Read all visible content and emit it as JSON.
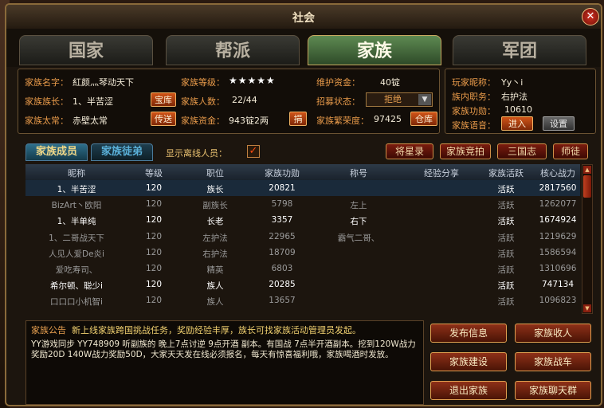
{
  "window": {
    "title": "社会",
    "close_glyph": "✕"
  },
  "tabs": [
    {
      "label": "国家",
      "active": false
    },
    {
      "label": "帮派",
      "active": false
    },
    {
      "label": "家族",
      "active": true
    },
    {
      "label": "军团",
      "active": false
    }
  ],
  "family": {
    "name_label": "家族名字：",
    "name": "紅颜灬琴动天下",
    "leader_label": "家族族长：",
    "leader": "1、半苦涩",
    "vice_label": "家族太常：",
    "vice": "赤壁太常",
    "level_label": "家族等级：",
    "level_stars": "★★★★★",
    "members_label": "家族人数：",
    "members": "22/44",
    "funds_label": "家族资金：",
    "funds": "943锭2两",
    "upkeep_label": "维护资金：",
    "upkeep": "40锭",
    "recruit_label": "招募状态：",
    "recruit_value": "拒绝",
    "prosperity_label": "家族繁荣度：",
    "prosperity": "97425",
    "btn_treasury": "宝库",
    "btn_transfer": "传送",
    "btn_donate": "捐",
    "btn_warehouse": "仓库"
  },
  "player": {
    "nick_label": "玩家昵称：",
    "nick": "Yy丶i",
    "role_label": "族内职务：",
    "role": "右护法",
    "merit_label": "家族功勋：",
    "merit": "10610",
    "voice_label": "家族语音：",
    "btn_enter": "进入",
    "btn_settings": "设置"
  },
  "subtabs": {
    "members": "家族成员",
    "apprentices": "家族徒弟"
  },
  "show_offline_label": "显示离线人员：",
  "show_offline_checked": "✓",
  "action_buttons": [
    "将星录",
    "家族竞拍",
    "三国志",
    "师徒"
  ],
  "table": {
    "headers": [
      "昵称",
      "等级",
      "职位",
      "家族功勋",
      "称号",
      "经验分享",
      "家族活跃",
      "核心战力"
    ],
    "rows": [
      {
        "name": "1、半苦涩",
        "level": "120",
        "position": "族长",
        "merit": "20821",
        "title": "",
        "exp": "",
        "active": "活跃",
        "power": "2817560",
        "online": true
      },
      {
        "name": "BizArt丶欧阳",
        "level": "120",
        "position": "副族长",
        "merit": "5798",
        "title": "左上",
        "exp": "",
        "active": "活跃",
        "power": "1262077",
        "online": false
      },
      {
        "name": "1、半单纯",
        "level": "120",
        "position": "长老",
        "merit": "3357",
        "title": "右下",
        "exp": "",
        "active": "活跃",
        "power": "1674924",
        "online": true
      },
      {
        "name": "1、二哥战天下",
        "level": "120",
        "position": "左护法",
        "merit": "22965",
        "title": "霸气二哥、",
        "exp": "",
        "active": "活跃",
        "power": "1219629",
        "online": false
      },
      {
        "name": "人见人爱De炎i",
        "level": "120",
        "position": "右护法",
        "merit": "18709",
        "title": "",
        "exp": "",
        "active": "活跃",
        "power": "1586594",
        "online": false
      },
      {
        "name": "爱吃寿司、",
        "level": "120",
        "position": "精英",
        "merit": "6803",
        "title": "",
        "exp": "",
        "active": "活跃",
        "power": "1310696",
        "online": false
      },
      {
        "name": "希尔顿、聪少i",
        "level": "120",
        "position": "族人",
        "merit": "20285",
        "title": "",
        "exp": "",
        "active": "活跃",
        "power": "747134",
        "online": true
      },
      {
        "name": "口口口小机智i",
        "level": "120",
        "position": "族人",
        "merit": "13657",
        "title": "",
        "exp": "",
        "active": "活跃",
        "power": "1096823",
        "online": false
      }
    ]
  },
  "notice": {
    "label": "家族公告",
    "headline": "新上线家族跨国挑战任务，奖励经验丰厚，族长可找家族活动管理员发起。",
    "body": "YY游戏同步 YY748909  听副族的 晚上7点讨逆 9点开酒 副本。有国战 7点半开酒副本。挖到120W战力奖励20D 140W战力奖励50D，大家天天发在线必须报名，每天有惊喜福利哦，家族喝酒时发放。"
  },
  "bottom_buttons": [
    "发布信息",
    "家族收人",
    "家族建设",
    "家族战车",
    "退出家族",
    "家族聊天群"
  ],
  "colors": {
    "accent_orange": "#e89a4a",
    "online_text": "#ffffff",
    "offline_text": "#9a9a9a",
    "active_tab": "#4e7a44"
  }
}
